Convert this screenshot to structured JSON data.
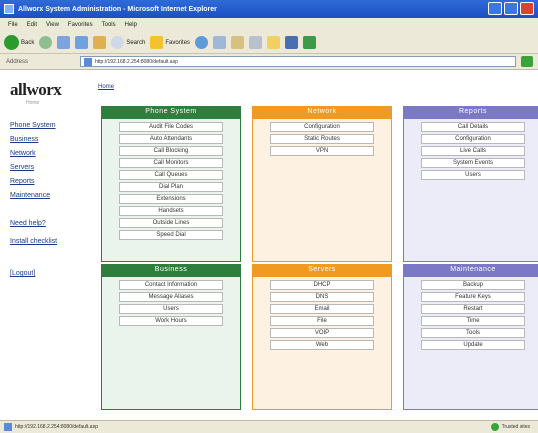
{
  "window": {
    "title": "Allworx System Administration - Microsoft Internet Explorer"
  },
  "menu": [
    "File",
    "Edit",
    "View",
    "Favorites",
    "Tools",
    "Help"
  ],
  "toolbar": {
    "back": "Back",
    "search": "Search",
    "favorites": "Favorites"
  },
  "address": {
    "label": "Address",
    "url": "http://192.168.2.254:8080/default.asp"
  },
  "sidebar": {
    "logo": "allworx",
    "tagline": "Home",
    "links": [
      "Phone System",
      "Business",
      "Network",
      "Servers",
      "Reports",
      "Maintenance",
      "Need help?",
      "Install checklist",
      "[Logout]"
    ]
  },
  "breadcrumb": "Home",
  "panels": [
    {
      "title": "Phone System",
      "color": "#2f7e3e",
      "items": [
        "Audit File Codes",
        "Auto Attendants",
        "Call Blocking",
        "Call Monitors",
        "Call Queues",
        "Dial Plan",
        "Extensions",
        "Handsets",
        "Outside Lines",
        "Speed Dial"
      ]
    },
    {
      "title": "Network",
      "color": "#f09a22",
      "items": [
        "Configuration",
        "Static Routes",
        "VPN"
      ]
    },
    {
      "title": "Reports",
      "color": "#7b78c6",
      "items": [
        "Call Details",
        "Configuration",
        "Live Calls",
        "System Events",
        "Users"
      ]
    },
    {
      "title": "Business",
      "color": "#2f7e3e",
      "items": [
        "Contact Information",
        "Message Aliases",
        "Users",
        "Work Hours"
      ]
    },
    {
      "title": "Servers",
      "color": "#f09a22",
      "items": [
        "DHCP",
        "DNS",
        "Email",
        "File",
        "VOIP",
        "Web"
      ]
    },
    {
      "title": "Maintenance",
      "color": "#7b78c6",
      "items": [
        "Backup",
        "Feature Keys",
        "Restart",
        "Time",
        "Tools",
        "Update"
      ]
    }
  ],
  "status": {
    "url": "http://192.168.2.254:8080/default.asp",
    "zone": "Trusted sites"
  }
}
